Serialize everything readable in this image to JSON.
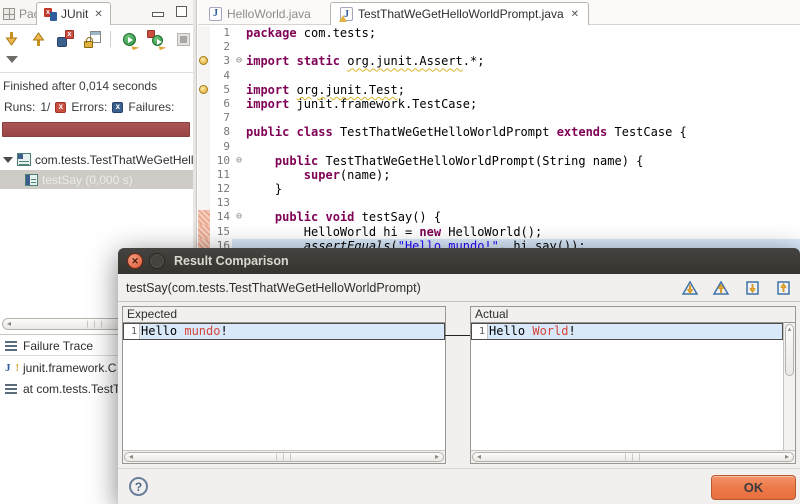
{
  "left_panel": {
    "tabs": {
      "package": "Package",
      "junit": "JUnit",
      "junit_close": "✕"
    },
    "toolbar_icons": [
      "next-failed-test",
      "previous-failed-test",
      "show-failures-only",
      "scroll-lock",
      "rerun-test",
      "rerun-failed-first",
      "stop-junit-session",
      "test-run-history"
    ],
    "status": "Finished after 0,014 seconds",
    "counts": {
      "runs_label": "Runs:",
      "runs_value": "1/",
      "errors_label": "Errors:",
      "failures_label": "Failures:",
      "error_badge": "x",
      "failure_badge": "x"
    },
    "tree": {
      "suite": "com.tests.TestThatWeGetHell",
      "test": "testSay (0,000 s)"
    },
    "failure_trace": {
      "title": "Failure Trace",
      "items": [
        "junit.framework.C",
        "at com.tests.TestT"
      ]
    }
  },
  "editor": {
    "tabs": {
      "inactive": "HelloWorld.java",
      "active": "TestThatWeGetHelloWorldPrompt.java",
      "close": "✕",
      "icon_letter": "J"
    },
    "lines": [
      {
        "n": "1",
        "segs": [
          {
            "c": "kw",
            "t": "package"
          },
          {
            "c": "pl",
            "t": " com.tests;"
          }
        ]
      },
      {
        "n": "2",
        "segs": []
      },
      {
        "n": "3",
        "fold": true,
        "warn": true,
        "segs": [
          {
            "c": "kw",
            "t": "import"
          },
          {
            "c": "pl",
            "t": " "
          },
          {
            "c": "kw",
            "t": "static"
          },
          {
            "c": "pl",
            "t": " "
          },
          {
            "c": "wrn",
            "t": "org.junit.Assert"
          },
          {
            "c": "pl",
            "t": ".*;"
          }
        ]
      },
      {
        "n": "4",
        "segs": []
      },
      {
        "n": "5",
        "warn": true,
        "segs": [
          {
            "c": "kw",
            "t": "import"
          },
          {
            "c": "pl",
            "t": " "
          },
          {
            "c": "wrn",
            "t": "org.junit.Test"
          },
          {
            "c": "pl",
            "t": ";"
          }
        ]
      },
      {
        "n": "6",
        "segs": [
          {
            "c": "kw",
            "t": "import"
          },
          {
            "c": "pl",
            "t": " junit.framework.TestCase;"
          }
        ]
      },
      {
        "n": "7",
        "segs": []
      },
      {
        "n": "8",
        "segs": [
          {
            "c": "kw",
            "t": "public"
          },
          {
            "c": "pl",
            "t": " "
          },
          {
            "c": "kw",
            "t": "class"
          },
          {
            "c": "pl",
            "t": " TestThatWeGetHelloWorldPrompt "
          },
          {
            "c": "kw",
            "t": "extends"
          },
          {
            "c": "pl",
            "t": " TestCase {"
          }
        ]
      },
      {
        "n": "9",
        "segs": []
      },
      {
        "n": "10",
        "fold": true,
        "segs": [
          {
            "c": "pl",
            "t": "    "
          },
          {
            "c": "kw",
            "t": "public"
          },
          {
            "c": "pl",
            "t": " TestThatWeGetHelloWorldPrompt(String name) {"
          }
        ]
      },
      {
        "n": "11",
        "segs": [
          {
            "c": "pl",
            "t": "        "
          },
          {
            "c": "kw",
            "t": "super"
          },
          {
            "c": "pl",
            "t": "(name);"
          }
        ]
      },
      {
        "n": "12",
        "segs": [
          {
            "c": "pl",
            "t": "    }"
          }
        ]
      },
      {
        "n": "13",
        "segs": []
      },
      {
        "n": "14",
        "fold": true,
        "marker": true,
        "segs": [
          {
            "c": "pl",
            "t": "    "
          },
          {
            "c": "kw",
            "t": "public"
          },
          {
            "c": "pl",
            "t": " "
          },
          {
            "c": "kw",
            "t": "void"
          },
          {
            "c": "pl",
            "t": " testSay() {"
          }
        ]
      },
      {
        "n": "15",
        "marker": true,
        "segs": [
          {
            "c": "pl",
            "t": "        HelloWorld hi = "
          },
          {
            "c": "kw",
            "t": "new"
          },
          {
            "c": "pl",
            "t": " HelloWorld();"
          }
        ]
      },
      {
        "n": "16",
        "marker": true,
        "current": true,
        "segs": [
          {
            "c": "pl",
            "t": "        "
          },
          {
            "c": "stat",
            "t": "assertEquals"
          },
          {
            "c": "pl",
            "t": "("
          },
          {
            "c": "str",
            "t": "\"Hello mundo!\""
          },
          {
            "c": "pl",
            "t": ", hi.say());"
          }
        ]
      }
    ]
  },
  "dialog": {
    "title": "Result Comparison",
    "test_header": "testSay(com.tests.TestThatWeGetHelloWorldPrompt)",
    "header_icons": [
      "next-difference",
      "previous-difference",
      "copy-current-change-right",
      "copy-current-change-left"
    ],
    "expected": {
      "label": "Expected",
      "line": "1",
      "pre": "Hello ",
      "diff": "mundo",
      "post": "!"
    },
    "actual": {
      "label": "Actual",
      "line": "1",
      "pre": "Hello ",
      "diff": "World",
      "post": "!"
    },
    "help_label": "?",
    "ok_label": "OK",
    "close_glyph": "✕"
  },
  "colors": {
    "failure_bar": "#9a4646",
    "keyword": "#7f0055",
    "string": "#2a00ff",
    "diff_red": "#d4453a",
    "current_line": "#d9e9fa",
    "titlebar": "#3a3935",
    "ok_button": "#ec7848"
  }
}
